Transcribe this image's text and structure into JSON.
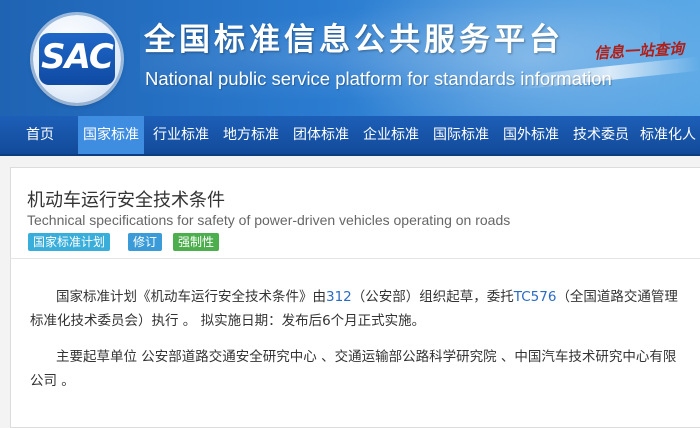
{
  "banner": {
    "logo_text": "SAC",
    "title_cn": "全国标准信息公共服务平台",
    "title_en": "National public service platform  for standards information",
    "slogan": "信息一站查询"
  },
  "nav": {
    "items": [
      {
        "label": "首页"
      },
      {
        "label": "国家标准",
        "active": true
      },
      {
        "label": "行业标准"
      },
      {
        "label": "地方标准"
      },
      {
        "label": "团体标准"
      },
      {
        "label": "企业标准"
      },
      {
        "label": "国际标准"
      },
      {
        "label": "国外标准"
      },
      {
        "label": "技术委员"
      },
      {
        "label": "标准化人"
      }
    ]
  },
  "document": {
    "title": "机动车运行安全技术条件",
    "subtitle": "Technical specifications for safety of power-driven vehicles operating on roads",
    "tags": [
      "国家标准计划",
      "修订",
      "强制性"
    ],
    "p1": {
      "part1": "国家标准计划《机动车运行安全技术条件》由",
      "code": "312",
      "part2": "（公安部）组织起草，委托",
      "tc": "TC576",
      "part3": "（全国道路交通管理",
      "part4": "标准化技术委员会）执行 。 拟实施日期：发布后6个月正式实施。"
    },
    "p2": {
      "line1": "主要起草单位 公安部道路交通安全研究中心 、交通运输部公路科学研究院 、中国汽车技术研究中心有限",
      "line2": "公司 。"
    }
  },
  "colors": {
    "nav_bg": "#124a99",
    "nav_active": "#3f8de0",
    "tag_plan": "#3aaedb",
    "tag_revise": "#3a9bd8",
    "tag_mandatory": "#4cae4c",
    "link": "#2a6bc4"
  }
}
